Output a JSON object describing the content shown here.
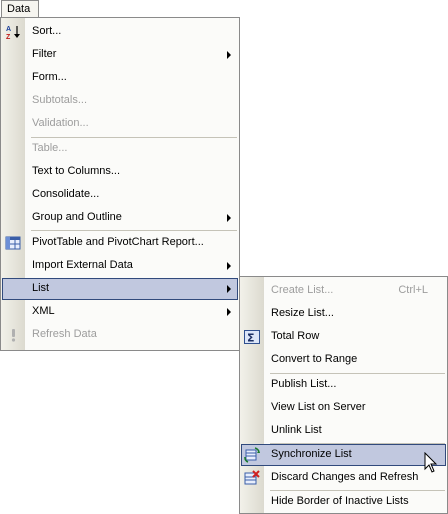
{
  "menubar": {
    "tab_label": "Data"
  },
  "data_menu": {
    "items": [
      {
        "label": "Sort...",
        "enabled": true
      },
      {
        "label": "Filter",
        "enabled": true,
        "submenu": true
      },
      {
        "label": "Form...",
        "enabled": true
      },
      {
        "label": "Subtotals...",
        "enabled": false
      },
      {
        "label": "Validation...",
        "enabled": false
      },
      {
        "label": "Table...",
        "enabled": false
      },
      {
        "label": "Text to Columns...",
        "enabled": true
      },
      {
        "label": "Consolidate...",
        "enabled": true
      },
      {
        "label": "Group and Outline",
        "enabled": true,
        "submenu": true
      },
      {
        "label": "PivotTable and PivotChart Report...",
        "enabled": true
      },
      {
        "label": "Import External Data",
        "enabled": true,
        "submenu": true
      },
      {
        "label": "List",
        "enabled": true,
        "submenu": true,
        "highlighted": true
      },
      {
        "label": "XML",
        "enabled": true,
        "submenu": true
      },
      {
        "label": "Refresh Data",
        "enabled": false
      }
    ]
  },
  "list_submenu": {
    "items": [
      {
        "label": "Create List...",
        "shortcut": "Ctrl+L",
        "enabled": false
      },
      {
        "label": "Resize List...",
        "enabled": true
      },
      {
        "label": "Total Row",
        "enabled": true
      },
      {
        "label": "Convert to Range",
        "enabled": true
      },
      {
        "label": "Publish List...",
        "enabled": true
      },
      {
        "label": "View List on Server",
        "enabled": true
      },
      {
        "label": "Unlink List",
        "enabled": true
      },
      {
        "label": "Synchronize List",
        "enabled": true,
        "highlighted": true
      },
      {
        "label": "Discard Changes and Refresh",
        "enabled": true
      },
      {
        "label": "Hide Border of Inactive Lists",
        "enabled": true
      }
    ]
  },
  "colors": {
    "highlight_bg": "#c1c8df",
    "highlight_border": "#314a7c",
    "disabled_text": "#9d9d9d"
  }
}
